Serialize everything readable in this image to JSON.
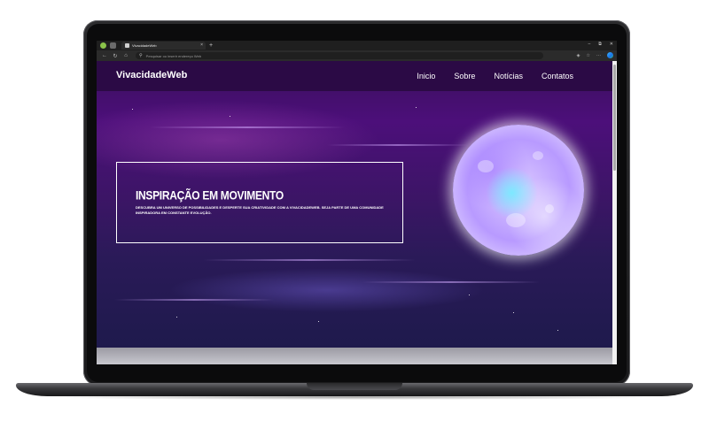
{
  "browser": {
    "tab_title": "VivacidadeWeb",
    "tab_close": "×",
    "new_tab": "+",
    "address_placeholder": "Pesquisar ou inserir endereço Web",
    "window_controls": [
      "–",
      "⧉",
      "✕"
    ]
  },
  "site": {
    "brand": "VivacidadeWeb",
    "menu": [
      "Inicio",
      "Sobre",
      "Notícias",
      "Contatos"
    ]
  },
  "hero": {
    "title": "INSPIRAÇÃO EM MOVIMENTO",
    "subtitle": "DESCUBRA UM UNIVERSO DE POSSIBILIDADES E DESPERTE SUA CRIATIVIDADE COM A VIVACIDADEWEB. SEJA PARTE DE UMA COMUNIDADE INSPIRADORA EM CONSTANTE EVOLUÇÃO."
  },
  "colors": {
    "navbar": "#2b0a45",
    "hero_bg": "#4c0f7a",
    "accent_moon": "#b89aff"
  },
  "icons": [
    "profile-icon",
    "tabs-icon",
    "page-icon",
    "back-icon",
    "refresh-icon",
    "home-icon",
    "search-icon",
    "shield-icon",
    "favorites-icon",
    "more-icon",
    "edge-copilot-icon"
  ]
}
